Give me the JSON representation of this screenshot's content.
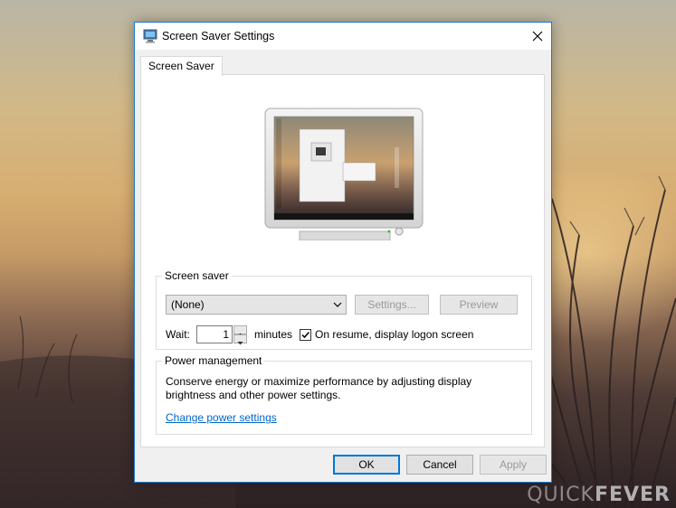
{
  "window": {
    "title": "Screen Saver Settings"
  },
  "tabs": [
    {
      "label": "Screen Saver"
    }
  ],
  "screen_saver": {
    "group_label": "Screen saver",
    "selected": "(None)",
    "settings_label": "Settings...",
    "preview_label": "Preview",
    "wait_label": "Wait:",
    "wait_value": "1",
    "minutes_label": "minutes",
    "logon_label": "On resume, display logon screen",
    "logon_checked": true
  },
  "power": {
    "group_label": "Power management",
    "description": "Conserve energy or maximize performance by adjusting display brightness and other power settings.",
    "link_label": "Change power settings"
  },
  "buttons": {
    "ok": "OK",
    "cancel": "Cancel",
    "apply": "Apply"
  },
  "watermark": {
    "prefix": "QUICK",
    "suffix": "FEVER"
  },
  "colors": {
    "accent": "#0078d7",
    "link": "#0066cc",
    "window_border": "#1a78d0"
  },
  "icons": [
    "screen-saver-icon",
    "close-icon",
    "chevron-down-icon",
    "spin-up-icon",
    "spin-down-icon",
    "checkmark-icon"
  ]
}
